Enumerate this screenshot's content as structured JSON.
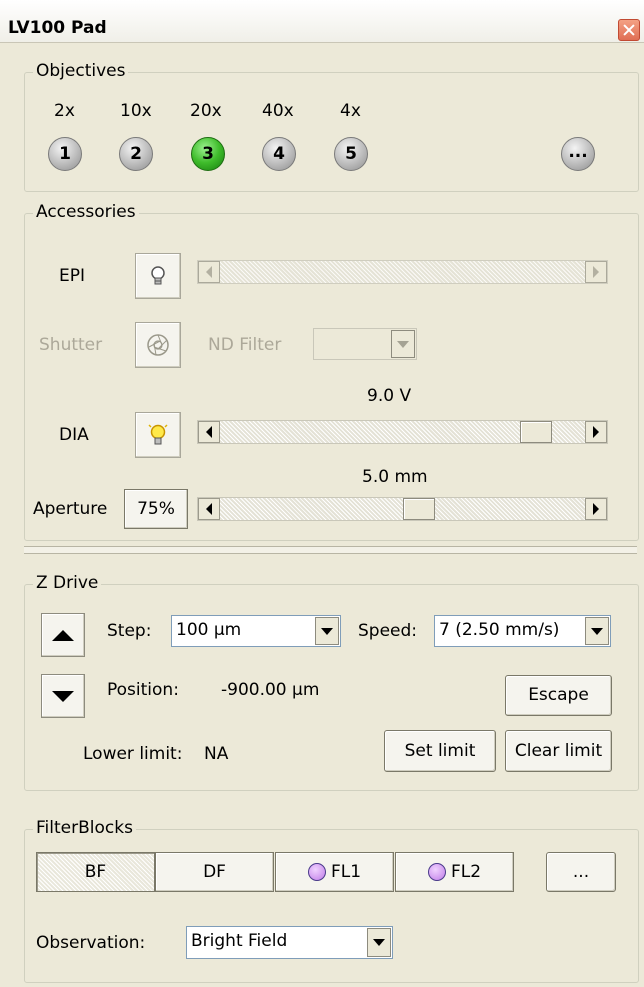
{
  "window": {
    "title": "LV100 Pad"
  },
  "objectives": {
    "legend": "Objectives",
    "items": [
      {
        "mag": "2x",
        "num": "1",
        "active": false
      },
      {
        "mag": "10x",
        "num": "2",
        "active": false
      },
      {
        "mag": "20x",
        "num": "3",
        "active": true
      },
      {
        "mag": "40x",
        "num": "4",
        "active": false
      },
      {
        "mag": "4x",
        "num": "5",
        "active": false
      }
    ],
    "more_label": "..."
  },
  "accessories": {
    "legend": "Accessories",
    "epi_label": "EPI",
    "shutter_label": "Shutter",
    "nd_filter_label": "ND Filter",
    "nd_filter_value": "",
    "dia_value": "9.0 V",
    "dia_label": "DIA",
    "dia_slider_fraction": 0.9,
    "aperture_value": "5.0 mm",
    "aperture_label": "Aperture",
    "aperture_button": "75%",
    "aperture_slider_fraction": 0.55
  },
  "zdrive": {
    "legend": "Z Drive",
    "step_label": "Step:",
    "step_value": "100 µm",
    "speed_label": "Speed:",
    "speed_value": "7 (2.50 mm/s)",
    "position_label": "Position:",
    "position_value": "-900.00 µm",
    "escape_label": "Escape",
    "lower_limit_label": "Lower limit:",
    "lower_limit_value": "NA",
    "set_limit_label": "Set limit",
    "clear_limit_label": "Clear limit"
  },
  "filterblocks": {
    "legend": "FilterBlocks",
    "buttons": [
      "BF",
      "DF",
      "FL1",
      "FL2"
    ],
    "selected": "BF",
    "more_label": "...",
    "observation_label": "Observation:",
    "observation_value": "Bright Field"
  },
  "colors": {
    "background": "#ece9d8",
    "active_objective": "#3fbc2b",
    "fl_circle": "#c07ce8",
    "disabled_text": "#aca899"
  }
}
